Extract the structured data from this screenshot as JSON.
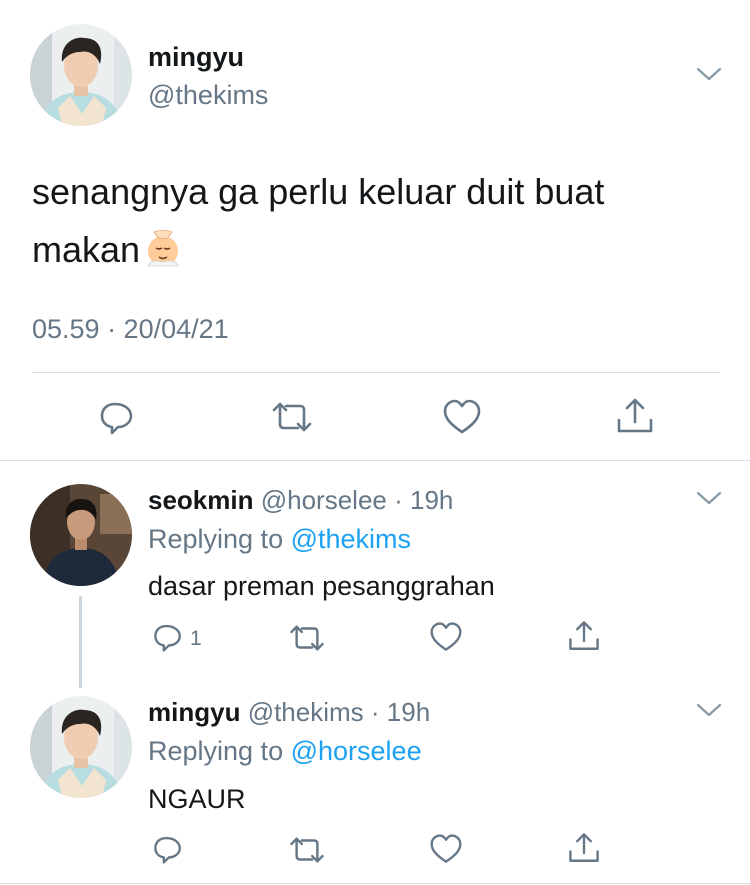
{
  "main_tweet": {
    "name": "mingyu",
    "handle": "@thekims",
    "text": "senangnya ga perlu keluar duit buat makan",
    "emoji_icon": "face-massage-emoji",
    "timestamp": "05.59 · 20/04/21",
    "actions": [
      "reply-icon",
      "retweet-icon",
      "like-icon",
      "share-icon"
    ]
  },
  "replies": [
    {
      "name": "seokmin",
      "handle": "@horselee",
      "time": "· 19h",
      "replying_prefix": "Replying to",
      "replying_to": "@thekims",
      "text": "dasar preman pesanggrahan",
      "reply_count": "1"
    },
    {
      "name": "mingyu",
      "handle": "@thekims",
      "time": "· 19h",
      "replying_prefix": "Replying to",
      "replying_to": "@horselee",
      "text": "NGAUR",
      "reply_count": ""
    }
  ],
  "colors": {
    "text": "#14171a",
    "secondary": "#657786",
    "link": "#1da1f2",
    "divider": "#d7dde2",
    "thread_line": "#ccd6dd"
  }
}
